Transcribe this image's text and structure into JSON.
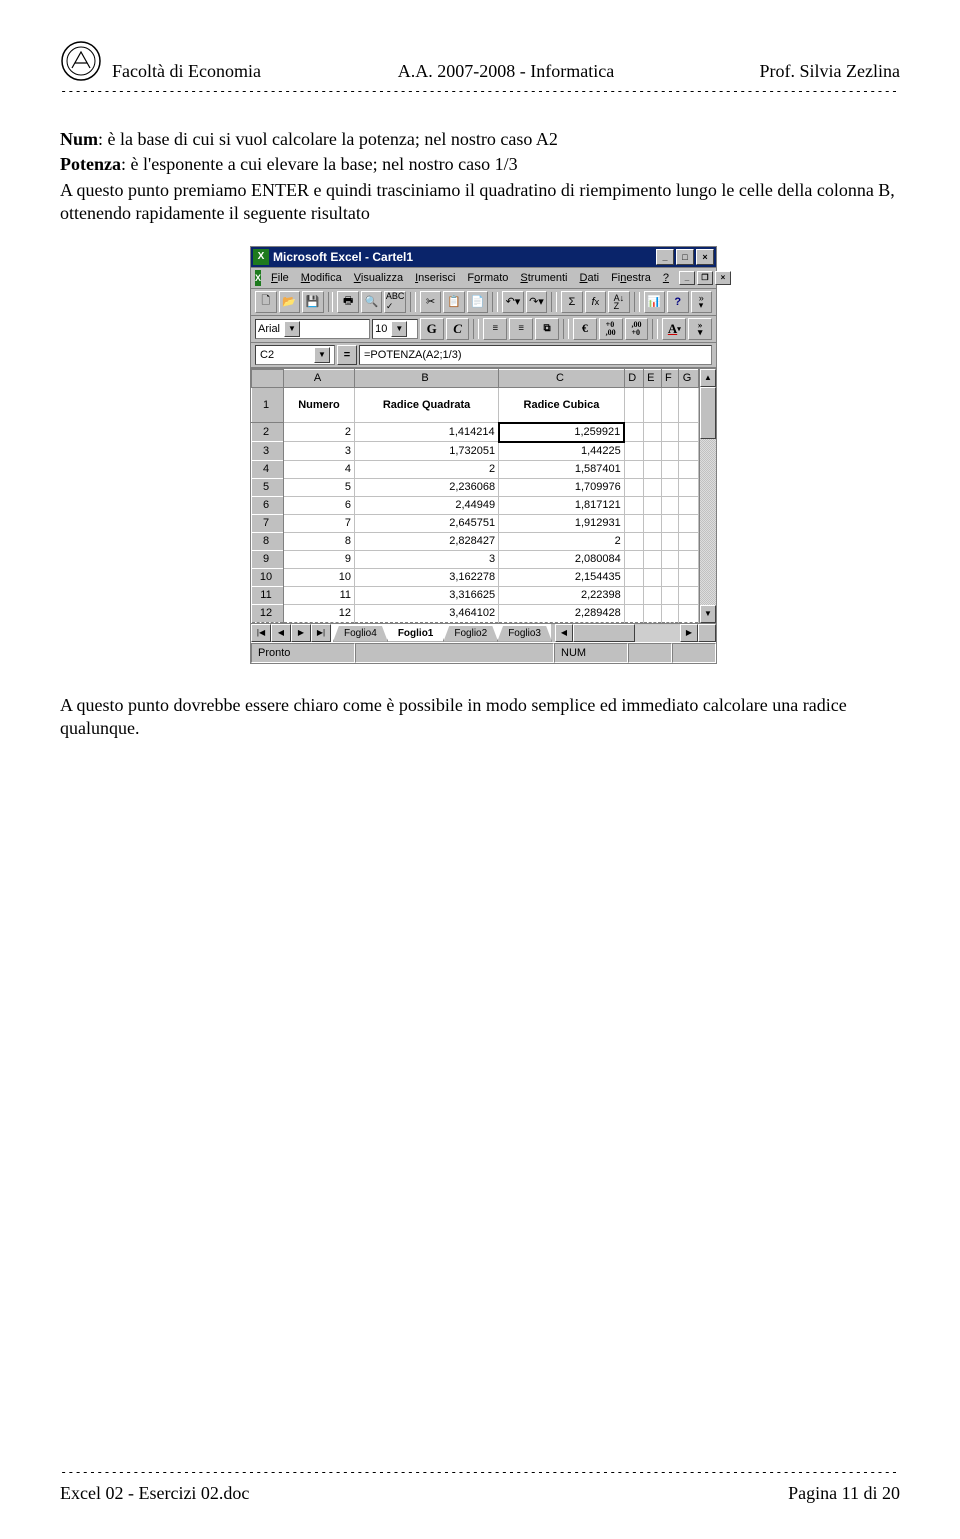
{
  "header": {
    "left": "Facoltà di Economia",
    "center": "A.A. 2007-2008 - Informatica",
    "right": "Prof. Silvia Zezlina",
    "dashes": "-----------------------------------------------------------------------------------------------------------------------------------"
  },
  "body": {
    "line1_label": "Num",
    "line1_rest": ": è la base di cui si vuol calcolare la potenza; nel nostro caso A2",
    "line2_label": "Potenza",
    "line2_rest": ": è l'esponente a cui elevare la base; nel nostro caso 1/3",
    "line3": "A questo punto premiamo ENTER e quindi trasciniamo il quadratino di riempimento lungo le celle della colonna B, ottenendo rapidamente il seguente risultato"
  },
  "excel": {
    "title": "Microsoft Excel - Cartel1",
    "menus": [
      "File",
      "Modifica",
      "Visualizza",
      "Inserisci",
      "Formato",
      "Strumenti",
      "Dati",
      "Finestra",
      "?"
    ],
    "font_name": "Arial",
    "font_size": "10",
    "name_box": "C2",
    "formula": "=POTENZA(A2;1/3)",
    "col_headers": [
      "A",
      "B",
      "C",
      "D",
      "E",
      "F",
      "G"
    ],
    "row1": {
      "a": "Numero",
      "b": "Radice Quadrata",
      "c": "Radice Cubica"
    },
    "rows": [
      {
        "n": "2",
        "a": "2",
        "b": "1,414214",
        "c": "1,259921"
      },
      {
        "n": "3",
        "a": "3",
        "b": "1,732051",
        "c": "1,44225"
      },
      {
        "n": "4",
        "a": "4",
        "b": "2",
        "c": "1,587401"
      },
      {
        "n": "5",
        "a": "5",
        "b": "2,236068",
        "c": "1,709976"
      },
      {
        "n": "6",
        "a": "6",
        "b": "2,44949",
        "c": "1,817121"
      },
      {
        "n": "7",
        "a": "7",
        "b": "2,645751",
        "c": "1,912931"
      },
      {
        "n": "8",
        "a": "8",
        "b": "2,828427",
        "c": "2"
      },
      {
        "n": "9",
        "a": "9",
        "b": "3",
        "c": "2,080084"
      },
      {
        "n": "10",
        "a": "10",
        "b": "3,162278",
        "c": "2,154435"
      },
      {
        "n": "11",
        "a": "11",
        "b": "3,316625",
        "c": "2,22398"
      },
      {
        "n": "12",
        "a": "12",
        "b": "3,464102",
        "c": "2,289428"
      }
    ],
    "sheet_tabs": [
      "Foglio4",
      "Foglio1",
      "Foglio2",
      "Foglio3"
    ],
    "active_tab": 1,
    "status": "Pronto",
    "status_num": "NUM"
  },
  "closing": "A questo punto dovrebbe essere chiaro come è possibile in modo semplice ed immediato calcolare una radice qualunque.",
  "footer": {
    "left": "Excel 02 - Esercizi 02.doc",
    "right": "Pagina 11 di 20",
    "dashes": "-----------------------------------------------------------------------------------------------------------------------------------"
  }
}
